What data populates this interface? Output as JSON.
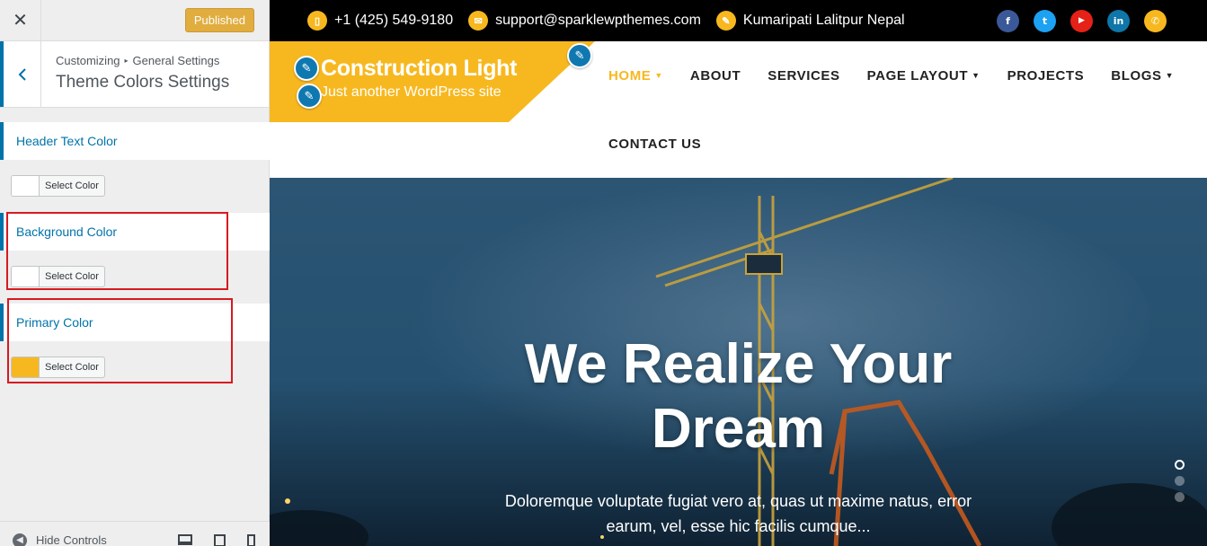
{
  "sidebar": {
    "close_icon": "close-icon",
    "publish_label": "Published",
    "breadcrumb": {
      "root": "Customizing",
      "parent": "General Settings"
    },
    "section_title": "Theme Colors Settings",
    "controls": [
      {
        "label": "Header Text Color",
        "button": "Select Color",
        "swatch": "#ffffff"
      },
      {
        "label": "Background Color",
        "button": "Select Color",
        "swatch": "#ffffff"
      },
      {
        "label": "Primary Color",
        "button": "Select Color",
        "swatch": "#f7b81f"
      }
    ],
    "footer": {
      "hide_controls": "Hide Controls"
    }
  },
  "preview": {
    "topbar": {
      "phone": "+1 (425) 549-9180",
      "email": "support@sparklewpthemes.com",
      "address": "Kumaripati Lalitpur Nepal",
      "socials": [
        {
          "name": "facebook-icon",
          "glyph": "f",
          "color": "#3b5998"
        },
        {
          "name": "twitter-icon",
          "glyph": "t",
          "color": "#1da1f2"
        },
        {
          "name": "youtube-icon",
          "glyph": "▶",
          "color": "#e62117"
        },
        {
          "name": "linkedin-icon",
          "glyph": "in",
          "color": "#0e76a8"
        },
        {
          "name": "phone-icon",
          "glyph": "✆",
          "color": "#f7b81f"
        }
      ]
    },
    "brand": {
      "title": "Construction Light",
      "tagline": "Just another WordPress site"
    },
    "nav": {
      "home": "HOME",
      "about": "ABOUT",
      "services": "SERVICES",
      "page_layout": "PAGE LAYOUT",
      "projects": "PROJECTS",
      "blogs": "BLOGS",
      "contact": "CONTACT US"
    },
    "hero": {
      "title_line1": "We Realize Your",
      "title_line2": "Dream",
      "text": "Doloremque voluptate fugiat vero at, quas ut maxime natus, error earum, vel, esse hic facilis cumque..."
    },
    "colors": {
      "primary": "#f7b81f",
      "link": "#0073aa",
      "highlight": "#d71920"
    }
  }
}
